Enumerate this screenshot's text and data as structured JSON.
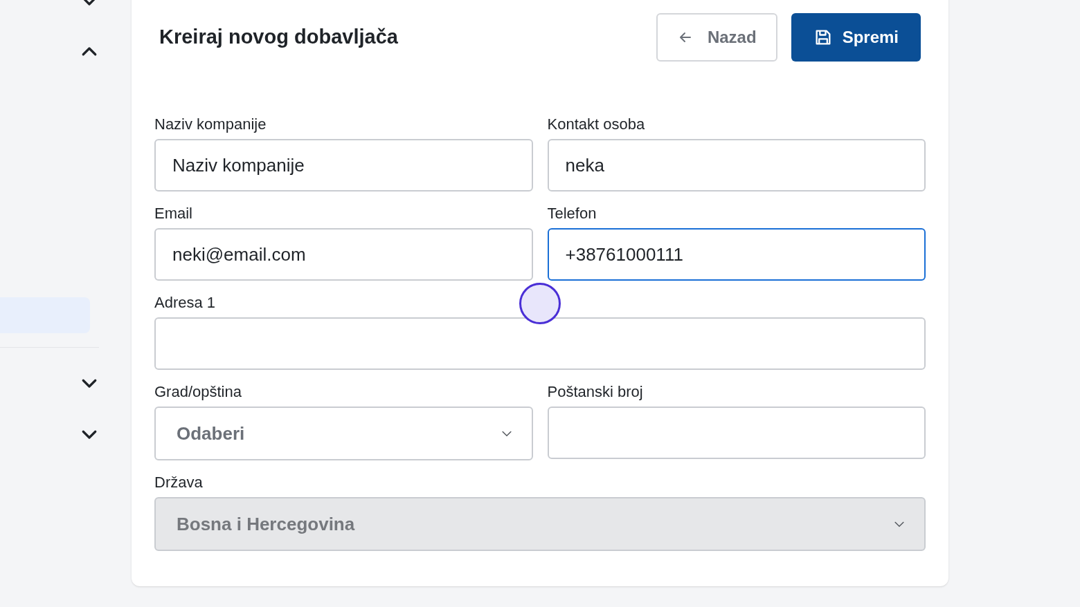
{
  "sidebar": {
    "top_toggles": [
      {
        "expanded": false
      },
      {
        "expanded": true
      }
    ],
    "highlighted_item": {
      "selected": true
    },
    "bottom_toggles": [
      {
        "expanded": false
      },
      {
        "expanded": false
      }
    ]
  },
  "page": {
    "title": "Kreiraj novog dobavljača",
    "buttons": [
      {
        "kind": "back",
        "label": "Nazad"
      },
      {
        "kind": "save",
        "label": "Spremi"
      }
    ]
  },
  "form": {
    "fields": [
      {
        "kind": "text",
        "label": "Naziv kompanije",
        "value": "Naziv kompanije",
        "wide": false,
        "focused": false,
        "disabled": false
      },
      {
        "kind": "text",
        "label": "Kontakt osoba",
        "value": "neka",
        "wide": false,
        "focused": false,
        "disabled": false
      },
      {
        "kind": "text",
        "label": "Email",
        "value": "neki@email.com",
        "wide": false,
        "focused": false,
        "disabled": false
      },
      {
        "kind": "text",
        "label": "Telefon",
        "value": "+38761000111",
        "wide": false,
        "focused": true,
        "disabled": false
      },
      {
        "kind": "text",
        "label": "Adresa 1",
        "wide": true,
        "focused": false,
        "disabled": false
      },
      {
        "kind": "select",
        "label": "Grad/opština",
        "placeholder": "Odaberi",
        "wide": false,
        "focused": false,
        "disabled": false
      },
      {
        "kind": "text",
        "label": "Poštanski broj",
        "wide": false,
        "focused": false,
        "disabled": false
      },
      {
        "kind": "select",
        "label": "Država",
        "value": "Bosna i Hercegovina",
        "wide": true,
        "focused": false,
        "disabled": true
      }
    ]
  }
}
